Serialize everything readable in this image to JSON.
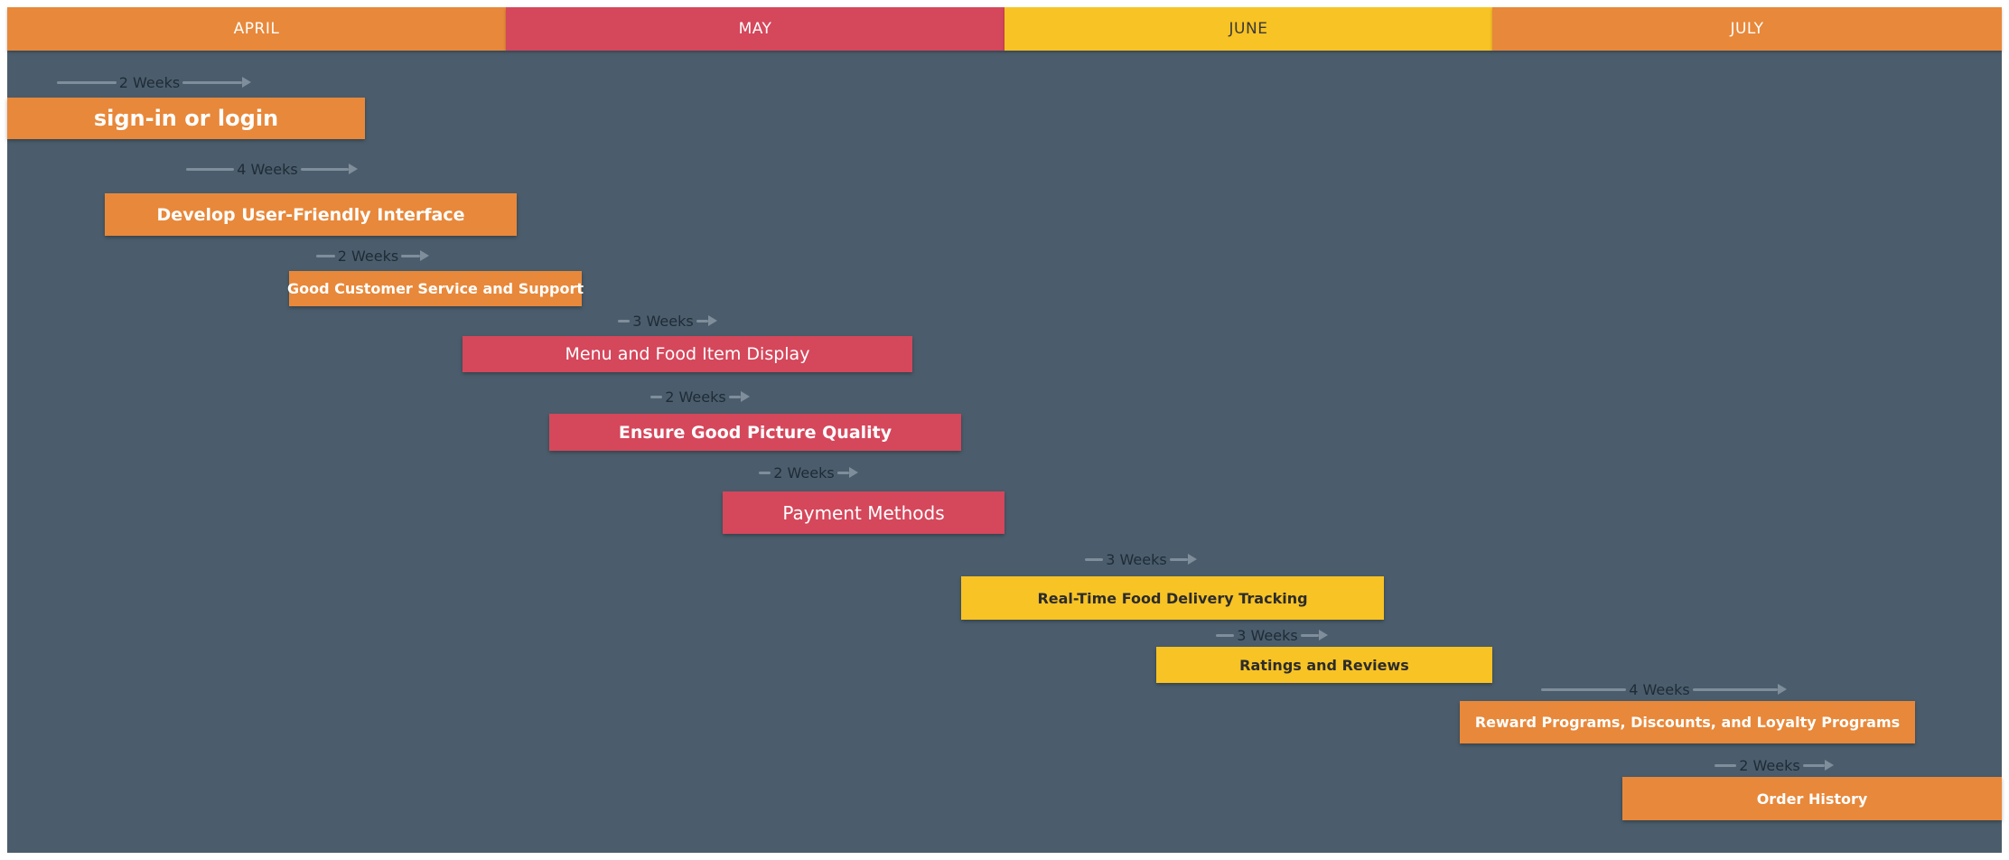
{
  "colors": {
    "orange": "#e8883a",
    "red": "#d5475b",
    "yellow": "#f8c324",
    "background": "#4b5d6c"
  },
  "months": [
    {
      "label": "APRIL",
      "color": "#e8883a"
    },
    {
      "label": "MAY",
      "color": "#d5475b"
    },
    {
      "label": "JUNE",
      "color": "#f8c324"
    },
    {
      "label": "JULY",
      "color": "#e8883a"
    }
  ],
  "tasks": [
    {
      "label": "sign-in or login",
      "duration": "2 Weeks",
      "color": "#e8883a"
    },
    {
      "label": "Develop User-Friendly Interface",
      "duration": "4 Weeks",
      "color": "#e8883a"
    },
    {
      "label": "Good Customer Service and Support",
      "duration": "2 Weeks",
      "color": "#e8883a"
    },
    {
      "label": "Menu and Food Item Display",
      "duration": "3 Weeks",
      "color": "#d5475b"
    },
    {
      "label": "Ensure Good Picture Quality",
      "duration": "2 Weeks",
      "color": "#d5475b"
    },
    {
      "label": "Payment Methods",
      "duration": "2 Weeks",
      "color": "#d5475b"
    },
    {
      "label": "Real-Time Food Delivery Tracking",
      "duration": "3 Weeks",
      "color": "#f8c324"
    },
    {
      "label": "Ratings and Reviews",
      "duration": "3 Weeks",
      "color": "#f8c324"
    },
    {
      "label": "Reward Programs, Discounts, and Loyalty Programs",
      "duration": "4 Weeks",
      "color": "#e8883a"
    },
    {
      "label": "Order History",
      "duration": "2 Weeks",
      "color": "#e8883a"
    }
  ]
}
